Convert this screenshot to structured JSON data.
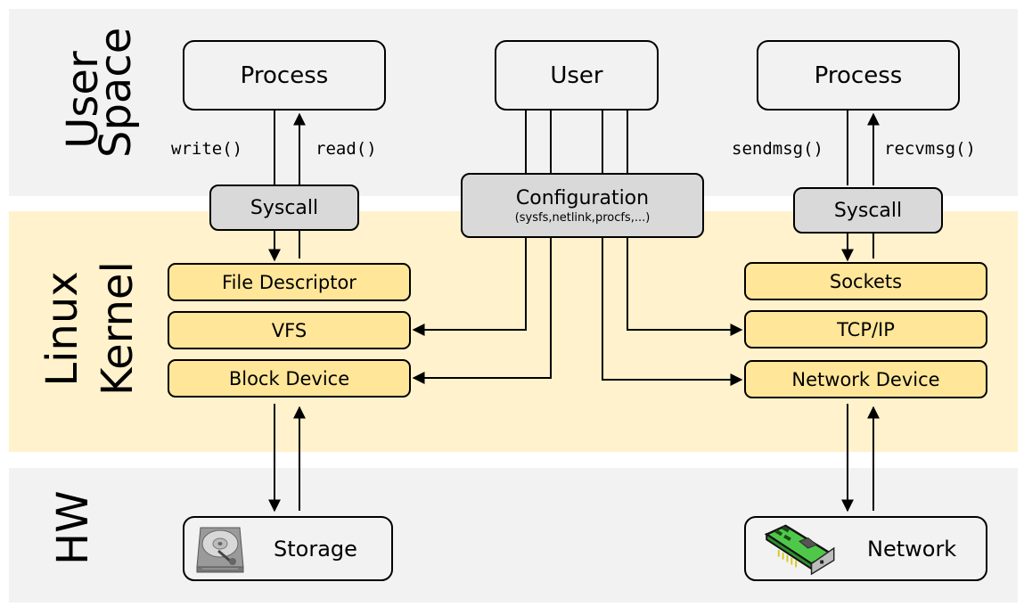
{
  "layers": {
    "user_space": [
      "User",
      "Space"
    ],
    "kernel": [
      "Linux",
      "Kernel"
    ],
    "hardware": [
      "HW"
    ]
  },
  "user_space": {
    "left_process": "Process",
    "user": "User",
    "right_process": "Process",
    "left_calls": {
      "down": "write()",
      "up": "read()"
    },
    "right_calls": {
      "down": "sendmsg()",
      "up": "recvmsg()"
    }
  },
  "syscall": {
    "left": "Syscall",
    "right": "Syscall"
  },
  "configuration": {
    "title": "Configuration",
    "subtitle": "(sysfs,netlink,procfs,...)"
  },
  "kernel": {
    "storage_stack": [
      "File Descriptor",
      "VFS",
      "Block Device"
    ],
    "network_stack": [
      "Sockets",
      "TCP/IP",
      "Network Device"
    ]
  },
  "hardware": {
    "storage": {
      "label": "Storage",
      "icon": "hard-drive-icon"
    },
    "network": {
      "label": "Network",
      "icon": "network-card-icon"
    }
  },
  "colors": {
    "user_band": "#f2f2f2",
    "kernel_band": "#fff2cc",
    "hw_band": "#f2f2f2",
    "kernel_box": "#ffe699",
    "syscall_box": "#d9d9d9"
  }
}
